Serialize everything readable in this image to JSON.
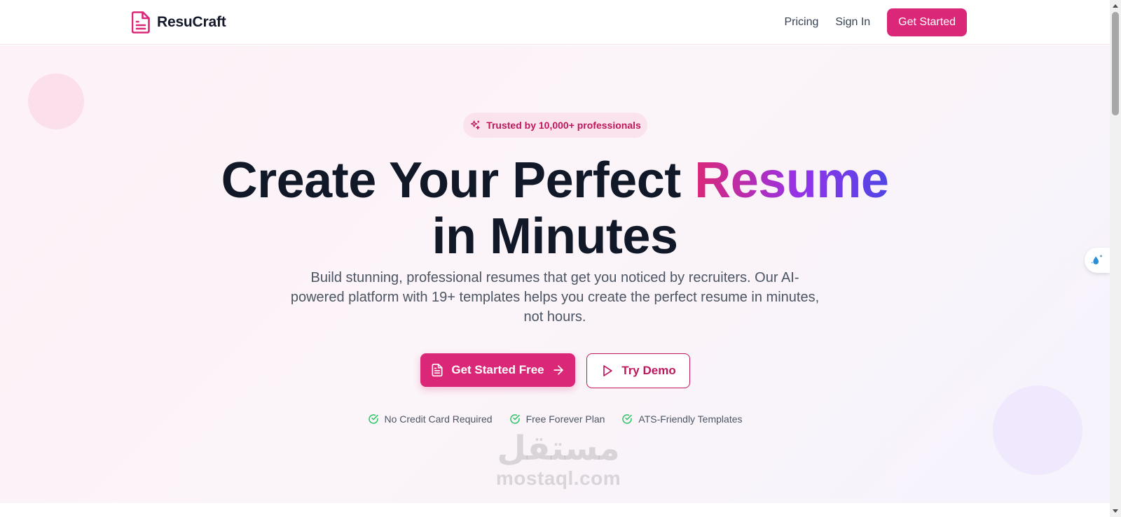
{
  "header": {
    "brand_name": "ResuCraft",
    "nav": {
      "pricing": "Pricing",
      "sign_in": "Sign In",
      "get_started": "Get Started"
    }
  },
  "hero": {
    "badge": "Trusted by 10,000+ professionals",
    "headline_part1": "Create Your Perfect ",
    "headline_highlight": "Resume",
    "headline_part2": "in Minutes",
    "subheadline": "Build stunning, professional resumes that get you noticed by recruiters. Our AI-powered platform with 19+ templates helps you create the perfect resume in minutes, not hours.",
    "primary_button": "Get Started Free",
    "secondary_button": "Try Demo",
    "features": [
      "No Credit Card Required",
      "Free Forever Plan",
      "ATS-Friendly Templates"
    ]
  },
  "watermark": {
    "arabic": "مستقل",
    "latin": "mostaql.com"
  },
  "colors": {
    "brand": "#db2777",
    "gradient_start": "#db2777",
    "gradient_mid": "#9333ea",
    "gradient_end": "#4f46e5",
    "check": "#22c55e"
  },
  "icons": {
    "brand": "document-icon",
    "badge": "sparkles-icon",
    "primary_button_left": "file-text-icon",
    "primary_button_right": "arrow-right-icon",
    "secondary_button": "play-icon",
    "feature": "check-circle-icon",
    "widget": "droplet-sparkle-icon"
  }
}
